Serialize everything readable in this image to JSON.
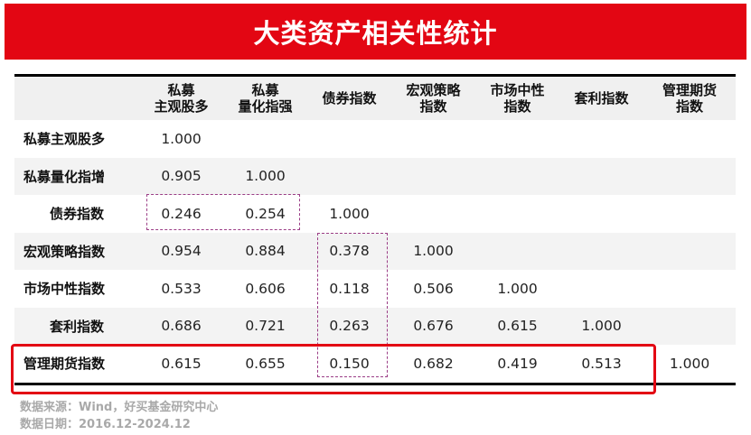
{
  "title": "大类资产相关性统计",
  "chart_data": {
    "type": "table",
    "columns": [
      [
        "私募",
        "主观股多"
      ],
      [
        "私募",
        "量化指强"
      ],
      [
        "债券指数"
      ],
      [
        "宏观策略",
        "指数"
      ],
      [
        "市场中性",
        "指数"
      ],
      [
        "套利指数"
      ],
      [
        "管理期货",
        "指数"
      ]
    ],
    "rows": [
      {
        "label": "私募主观股多",
        "values": [
          "1.000",
          "",
          "",
          "",
          "",
          "",
          ""
        ]
      },
      {
        "label": "私募量化指增",
        "values": [
          "0.905",
          "1.000",
          "",
          "",
          "",
          "",
          ""
        ]
      },
      {
        "label": "债券指数",
        "values": [
          "0.246",
          "0.254",
          "1.000",
          "",
          "",
          "",
          ""
        ]
      },
      {
        "label": "宏观策略指数",
        "values": [
          "0.954",
          "0.884",
          "0.378",
          "1.000",
          "",
          "",
          ""
        ]
      },
      {
        "label": "市场中性指数",
        "values": [
          "0.533",
          "0.606",
          "0.118",
          "0.506",
          "1.000",
          "",
          ""
        ]
      },
      {
        "label": "套利指数",
        "values": [
          "0.686",
          "0.721",
          "0.263",
          "0.676",
          "0.615",
          "1.000",
          ""
        ]
      },
      {
        "label": "管理期货指数",
        "values": [
          "0.615",
          "0.655",
          "0.150",
          "0.682",
          "0.419",
          "0.513",
          "1.000"
        ]
      }
    ]
  },
  "source": {
    "line1": "数据来源：Wind，好买基金研究中心",
    "line2": "数据日期：2016.12-2024.12"
  },
  "colors": {
    "accent": "#e30613",
    "highlight_dash": "#9b3d86"
  }
}
